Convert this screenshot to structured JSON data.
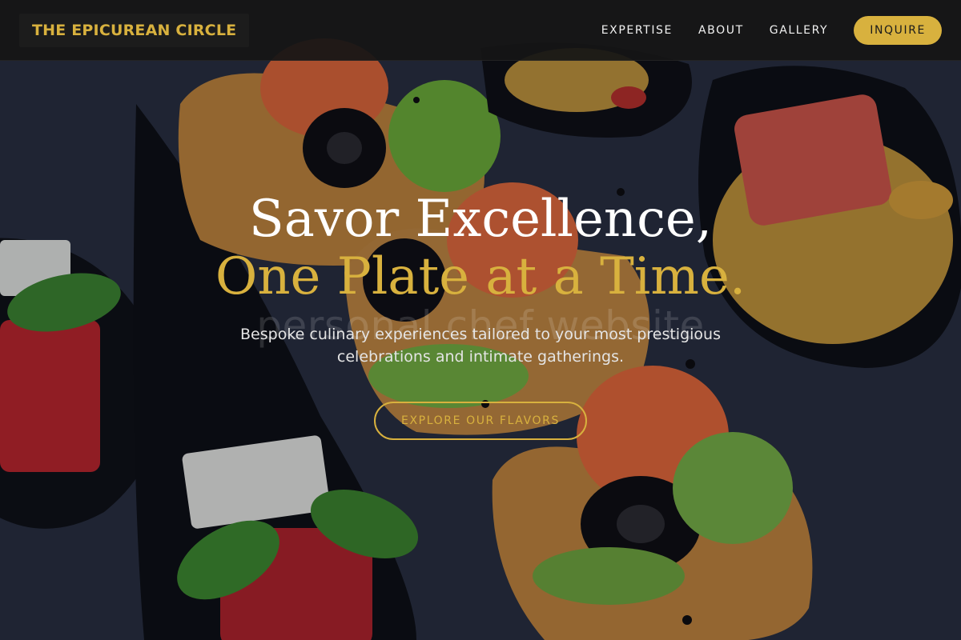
{
  "brand": {
    "name": "THE EPICUREAN CIRCLE"
  },
  "nav": {
    "links": [
      "EXPERTISE",
      "ABOUT",
      "GALLERY"
    ],
    "cta_label": "INQUIRE"
  },
  "hero": {
    "headline_line1": "Savor Excellence,",
    "headline_line2": "One Plate at a Time.",
    "watermark": "personal chef website",
    "subtitle": "Bespoke culinary experiences tailored to your most prestigious celebrations and intimate gatherings.",
    "cta_label": "EXPLORE OUR FLAVORS"
  },
  "colors": {
    "accent": "#d8b13e",
    "navbar_bg": "#161616",
    "text_light": "#ffffff"
  }
}
